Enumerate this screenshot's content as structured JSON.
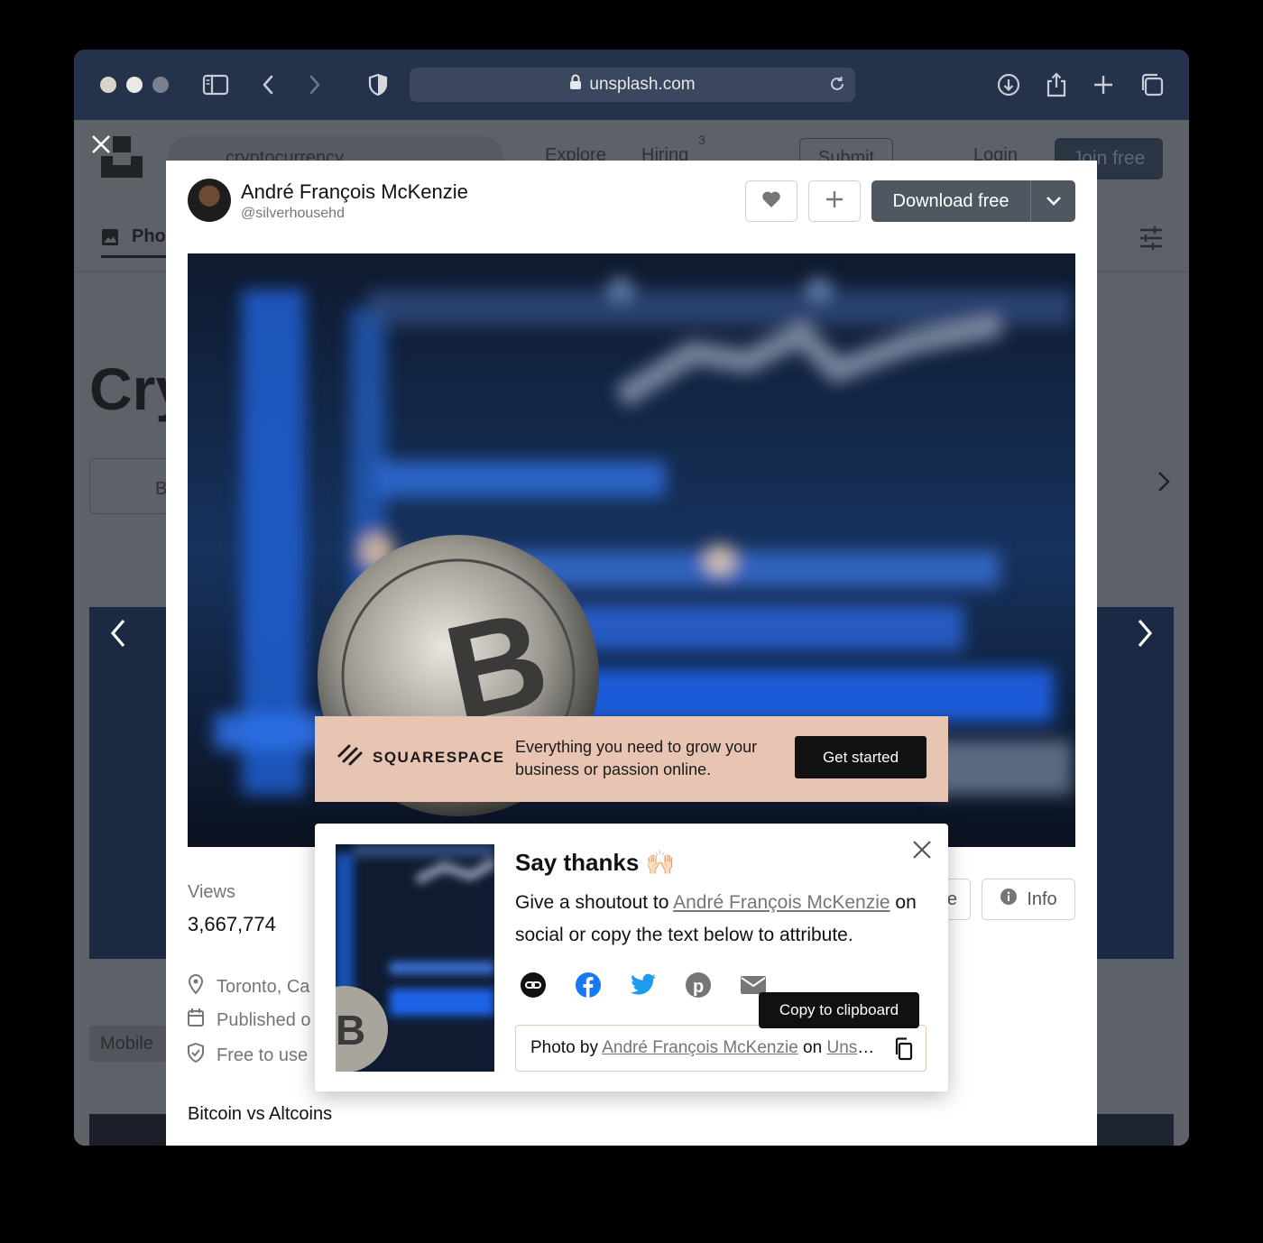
{
  "browser": {
    "url": "unsplash.com",
    "icons": [
      "sidebar-icon",
      "back-icon",
      "forward-icon",
      "shield-icon",
      "lock-icon",
      "reload-icon",
      "download-icon",
      "share-icon",
      "new-tab-icon",
      "tabs-icon"
    ]
  },
  "background_page": {
    "search_value": "cryptocurrency",
    "nav": [
      "Explore",
      "Hiring"
    ],
    "hiring_badge": "3",
    "submit_label": "Submit",
    "login_label": "Login",
    "join_label": "Join free",
    "tab_label": "Pho",
    "heading_fragment": "Cry",
    "chip_fragment": "B",
    "card_label_fragment": "Mobile"
  },
  "modal": {
    "author_name": "André François McKenzie",
    "author_handle": "@silverhousehd",
    "download_label": "Download free",
    "views_label": "Views",
    "views_value": "3,667,774",
    "location": "Toronto, Ca",
    "published": "Published o",
    "license": "Free to use",
    "description": "Bitcoin vs Altcoins",
    "share_fragment": "e",
    "info_label": "Info"
  },
  "ad": {
    "brand": "SQUARESPACE",
    "text": "Everything you need to grow your business or passion online.",
    "cta": "Get started"
  },
  "thanks": {
    "title": "Say thanks 🙌🏻",
    "body_prefix": "Give a shoutout to ",
    "body_link": "André François McKenzie",
    "body_suffix": " on social or copy the text below to attribute.",
    "credit_prefix": "Photo by ",
    "credit_author": "André François McKenzie",
    "credit_mid": " on ",
    "credit_site": "Unsplash",
    "tooltip": "Copy to clipboard"
  },
  "colors": {
    "titlebar": "#24324c",
    "download_button": "#4f5860",
    "ad_background": "#e8c5b2",
    "tooltip": "#111111"
  }
}
